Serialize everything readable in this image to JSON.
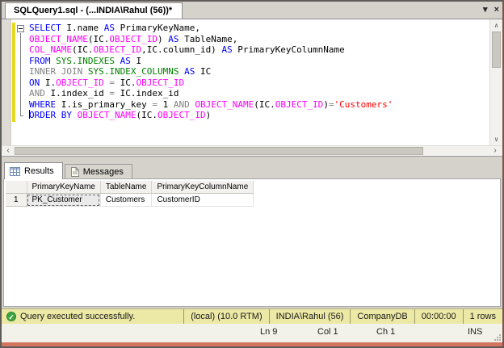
{
  "window": {
    "tab_title": "SQLQuery1.sql - (...INDIA\\Rahul (56))*"
  },
  "icons": {
    "dropdown": "▾",
    "close": "×",
    "scroll_up": "∧",
    "scroll_down": "∨",
    "scroll_left": "‹",
    "scroll_right": "›",
    "check": "✓"
  },
  "editor": {
    "syntax_colors": {
      "keyword": "#0000ff",
      "function": "#ff00ff",
      "system_object": "#008000",
      "operator": "#808080",
      "string": "#ff0000",
      "identifier": "#000000"
    },
    "lines": [
      {
        "tokens": [
          {
            "t": "kw",
            "s": "SELECT"
          },
          {
            "t": "id",
            "s": " I.name "
          },
          {
            "t": "kw",
            "s": "AS"
          },
          {
            "t": "id",
            "s": " PrimaryKeyName,"
          }
        ]
      },
      {
        "tokens": [
          {
            "t": "fn",
            "s": "OBJECT_NAME"
          },
          {
            "t": "id",
            "s": "(IC."
          },
          {
            "t": "fn",
            "s": "OBJECT_ID"
          },
          {
            "t": "id",
            "s": ") "
          },
          {
            "t": "kw",
            "s": "AS"
          },
          {
            "t": "id",
            "s": " TableName,"
          }
        ]
      },
      {
        "tokens": [
          {
            "t": "fn",
            "s": "COL_NAME"
          },
          {
            "t": "id",
            "s": "(IC."
          },
          {
            "t": "fn",
            "s": "OBJECT_ID"
          },
          {
            "t": "id",
            "s": ",IC.column_id) "
          },
          {
            "t": "kw",
            "s": "AS"
          },
          {
            "t": "id",
            "s": " PrimaryKeyColumnName"
          }
        ]
      },
      {
        "tokens": [
          {
            "t": "kw",
            "s": "FROM"
          },
          {
            "t": "id",
            "s": " "
          },
          {
            "t": "sys",
            "s": "SYS.INDEXES"
          },
          {
            "t": "id",
            "s": " "
          },
          {
            "t": "kw",
            "s": "AS"
          },
          {
            "t": "id",
            "s": " I"
          }
        ]
      },
      {
        "tokens": [
          {
            "t": "op",
            "s": "INNER JOIN"
          },
          {
            "t": "id",
            "s": " "
          },
          {
            "t": "sys",
            "s": "SYS.INDEX_COLUMNS"
          },
          {
            "t": "id",
            "s": " "
          },
          {
            "t": "kw",
            "s": "AS"
          },
          {
            "t": "id",
            "s": " IC"
          }
        ]
      },
      {
        "tokens": [
          {
            "t": "kw",
            "s": "ON"
          },
          {
            "t": "id",
            "s": " I."
          },
          {
            "t": "fn",
            "s": "OBJECT_ID"
          },
          {
            "t": "id",
            "s": " "
          },
          {
            "t": "op",
            "s": "="
          },
          {
            "t": "id",
            "s": " IC."
          },
          {
            "t": "fn",
            "s": "OBJECT_ID"
          }
        ]
      },
      {
        "tokens": [
          {
            "t": "op",
            "s": "AND"
          },
          {
            "t": "id",
            "s": " I.index_id "
          },
          {
            "t": "op",
            "s": "="
          },
          {
            "t": "id",
            "s": " IC.index_id"
          }
        ]
      },
      {
        "tokens": [
          {
            "t": "kw",
            "s": "WHERE"
          },
          {
            "t": "id",
            "s": " I.is_primary_key "
          },
          {
            "t": "op",
            "s": "="
          },
          {
            "t": "id",
            "s": " 1 "
          },
          {
            "t": "op",
            "s": "AND"
          },
          {
            "t": "id",
            "s": " "
          },
          {
            "t": "fn",
            "s": "OBJECT_NAME"
          },
          {
            "t": "id",
            "s": "(IC."
          },
          {
            "t": "fn",
            "s": "OBJECT_ID"
          },
          {
            "t": "id",
            "s": ")"
          },
          {
            "t": "op",
            "s": "="
          },
          {
            "t": "str",
            "s": "'Customers'"
          }
        ]
      },
      {
        "caret": true,
        "tokens": [
          {
            "t": "kw",
            "s": "ORDER BY"
          },
          {
            "t": "id",
            "s": " "
          },
          {
            "t": "fn",
            "s": "OBJECT_NAME"
          },
          {
            "t": "id",
            "s": "(IC."
          },
          {
            "t": "fn",
            "s": "OBJECT_ID"
          },
          {
            "t": "id",
            "s": ")"
          }
        ]
      }
    ]
  },
  "results_pane": {
    "tabs": [
      {
        "label": "Results",
        "active": true
      },
      {
        "label": "Messages",
        "active": false
      }
    ],
    "grid": {
      "columns": [
        "PrimaryKeyName",
        "TableName",
        "PrimaryKeyColumnName"
      ],
      "rows": [
        {
          "num": "1",
          "cells": [
            "PK_Customer",
            "Customers",
            "CustomerID"
          ],
          "selected_cell": 0
        }
      ]
    }
  },
  "status_bar": {
    "message": "Query executed successfully.",
    "segments": [
      "(local) (10.0 RTM)",
      "INDIA\\Rahul (56)",
      "CompanyDB",
      "00:00:00",
      "1 rows"
    ]
  },
  "position_bar": {
    "line": "Ln 9",
    "column": "Col 1",
    "character": "Ch 1",
    "mode": "INS"
  },
  "colors": {
    "status_bar_bg": "#ece8a5",
    "success_green": "#3da33f",
    "change_bar_yellow": "#e6d822",
    "window_bottom_edge": "#d3745e",
    "chrome_gray": "#d5d2cb"
  }
}
